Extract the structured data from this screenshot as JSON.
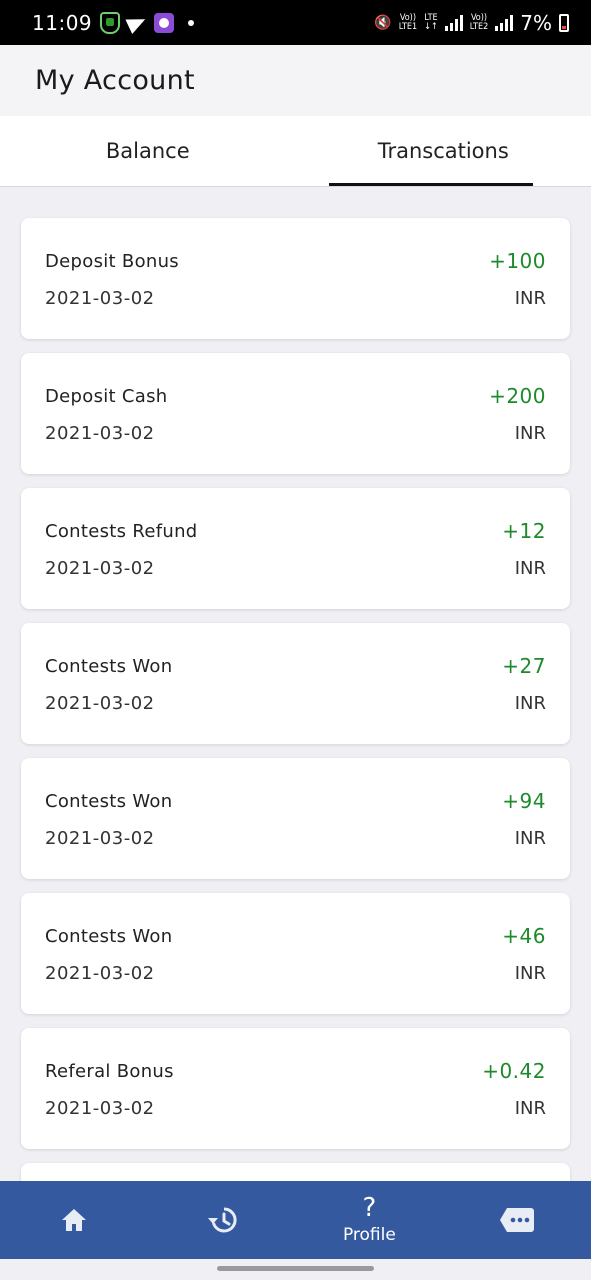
{
  "status_bar": {
    "time": "11:09",
    "net1_top": "Vo))",
    "net1_bottom": "LTE1",
    "net_lte": "LTE",
    "net2_top": "Vo))",
    "net2_bottom": "LTE2",
    "battery": "7%"
  },
  "header": {
    "title": "My Account"
  },
  "tabs": [
    {
      "label": "Balance",
      "active": false
    },
    {
      "label": "Transcations",
      "active": true
    }
  ],
  "transactions": [
    {
      "title": "Deposit Bonus",
      "date": "2021-03-02",
      "amount": "+100",
      "currency": "INR"
    },
    {
      "title": "Deposit Cash",
      "date": "2021-03-02",
      "amount": "+200",
      "currency": "INR"
    },
    {
      "title": "Contests Refund",
      "date": "2021-03-02",
      "amount": "+12",
      "currency": "INR"
    },
    {
      "title": "Contests Won",
      "date": "2021-03-02",
      "amount": "+27",
      "currency": "INR"
    },
    {
      "title": "Contests Won",
      "date": "2021-03-02",
      "amount": "+94",
      "currency": "INR"
    },
    {
      "title": "Contests Won",
      "date": "2021-03-02",
      "amount": "+46",
      "currency": "INR"
    },
    {
      "title": "Referal Bonus",
      "date": "2021-03-02",
      "amount": "+0.42",
      "currency": "INR"
    }
  ],
  "bottom_nav": {
    "items": [
      {
        "icon": "home-icon"
      },
      {
        "icon": "history-icon"
      },
      {
        "icon": "help-icon",
        "glyph": "?",
        "label": "Profile"
      },
      {
        "icon": "chat-icon"
      }
    ]
  },
  "colors": {
    "accent_green": "#1e8a2b",
    "nav_blue": "#35599f",
    "background": "#efeff4"
  }
}
